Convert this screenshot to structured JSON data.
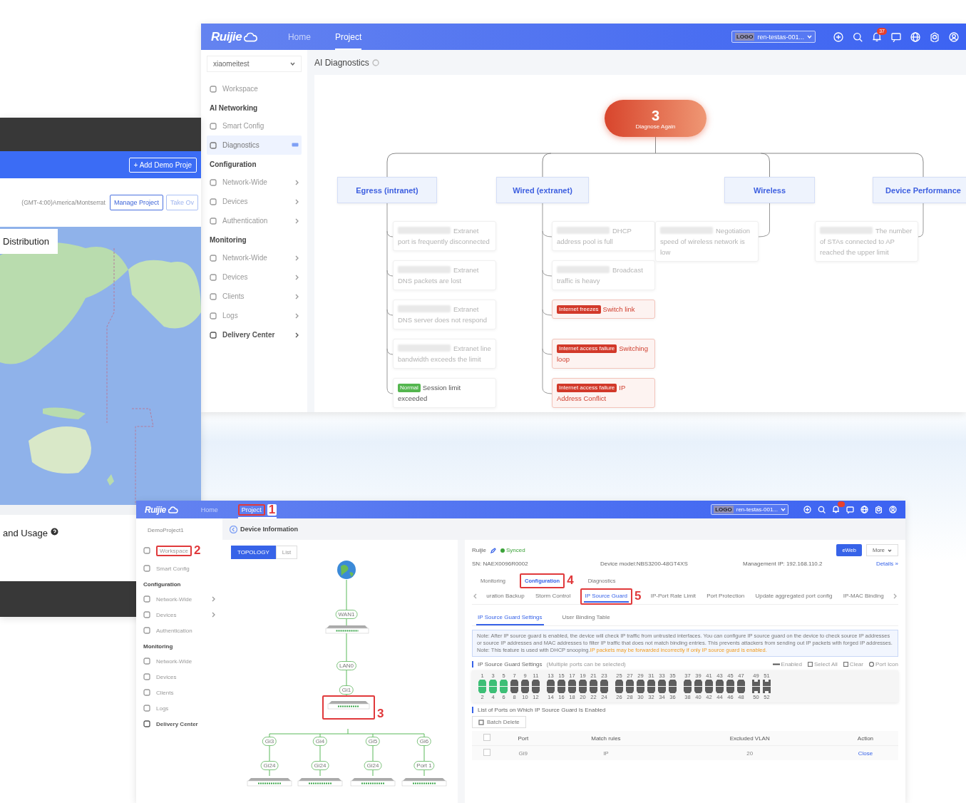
{
  "top_window": {
    "header": {
      "logo": "Ruijie",
      "nav": [
        {
          "label": "Home",
          "selected": false
        },
        {
          "label": "Project",
          "selected": true
        }
      ],
      "project_select": {
        "logo": "LOGO",
        "value": "ren-testas-001..."
      },
      "notification_count": "37"
    },
    "sidebar": {
      "project": "xiaomeitest",
      "items": [
        {
          "kind": "link",
          "label": "Workspace",
          "selected": false,
          "submenu": false,
          "badge": false
        },
        {
          "kind": "heading",
          "label": "AI Networking"
        },
        {
          "kind": "link",
          "label": "Smart Config",
          "selected": false,
          "submenu": false,
          "badge": false
        },
        {
          "kind": "link",
          "label": "Diagnostics",
          "selected": true,
          "submenu": false,
          "badge": true
        },
        {
          "kind": "heading",
          "label": "Configuration"
        },
        {
          "kind": "link",
          "label": "Network-Wide",
          "selected": false,
          "submenu": true,
          "badge": false
        },
        {
          "kind": "link",
          "label": "Devices",
          "selected": false,
          "submenu": true,
          "badge": false
        },
        {
          "kind": "link",
          "label": "Authentication",
          "selected": false,
          "submenu": true,
          "badge": false
        },
        {
          "kind": "heading",
          "label": "Monitoring"
        },
        {
          "kind": "link",
          "label": "Network-Wide",
          "selected": false,
          "submenu": true,
          "badge": false
        },
        {
          "kind": "link",
          "label": "Devices",
          "selected": false,
          "submenu": true,
          "badge": false
        },
        {
          "kind": "link",
          "label": "Clients",
          "selected": false,
          "submenu": true,
          "badge": false
        },
        {
          "kind": "link",
          "label": "Logs",
          "selected": false,
          "submenu": true,
          "badge": false
        },
        {
          "kind": "group",
          "label": "Delivery Center",
          "selected": false,
          "submenu": true,
          "badge": false
        }
      ]
    },
    "page_title": "AI Diagnostics",
    "diagnosis": {
      "count": "3",
      "action": "Diagnose Again",
      "categories": [
        {
          "name": "Egress (intranet)",
          "issues": [
            {
              "kind": "pending",
              "text": "Extranet port is frequently disconnected"
            },
            {
              "kind": "pending",
              "text": "Extranet DNS packets are lost"
            },
            {
              "kind": "pending",
              "text": "Extranet DNS server does not respond"
            },
            {
              "kind": "pending",
              "text": "Extranet line bandwidth exceeds the limit"
            },
            {
              "kind": "normal",
              "tag": "Normal",
              "text": "Session limit exceeded"
            }
          ]
        },
        {
          "name": "Wired (extranet)",
          "issues": [
            {
              "kind": "pending",
              "text": "DHCP address pool is full"
            },
            {
              "kind": "pending",
              "text": "Broadcast traffic is heavy"
            },
            {
              "kind": "fault",
              "tag": "Internet freezes",
              "text": "Switch link"
            },
            {
              "kind": "fault",
              "tag": "Internet access failure",
              "text": "Switching loop"
            },
            {
              "kind": "fault",
              "tag": "Internet access failure",
              "text": "IP Address Conflict"
            }
          ]
        },
        {
          "name": "Wireless",
          "issues": [
            {
              "kind": "pending",
              "text": "Negotiation speed of wireless network is low"
            }
          ]
        },
        {
          "name": "Device Performance",
          "issues": [
            {
              "kind": "pending",
              "text": "The number of STAs connected to AP reached the upper limit"
            }
          ]
        }
      ]
    }
  },
  "map_window": {
    "add_button": "+ Add Demo Proje",
    "timezone": "(GMT-4:00)America/Montserrat",
    "buttons": [
      "Manage Project",
      "Take Ov"
    ],
    "map_title": "Distribution",
    "usage_title": "and Usage"
  },
  "bottom_window": {
    "header": {
      "logo": "Ruijie",
      "nav": [
        {
          "label": "Home",
          "selected": false
        },
        {
          "label": "Project",
          "selected": true,
          "callout": "1"
        }
      ],
      "project_select": {
        "logo": "LOGO",
        "value": "ren-testas-001..."
      }
    },
    "sidebar": {
      "project": "DemoProject1",
      "items": [
        {
          "kind": "link",
          "label": "Workspace",
          "selected": false,
          "submenu": false,
          "callout": "2"
        },
        {
          "kind": "link",
          "label": "Smart Config",
          "selected": false,
          "submenu": false
        },
        {
          "kind": "heading",
          "label": "Configuration"
        },
        {
          "kind": "link",
          "label": "Network-Wide",
          "selected": false,
          "submenu": true
        },
        {
          "kind": "link",
          "label": "Devices",
          "selected": false,
          "submenu": true
        },
        {
          "kind": "link",
          "label": "Authentication",
          "selected": false,
          "submenu": false
        },
        {
          "kind": "heading",
          "label": "Monitoring"
        },
        {
          "kind": "link",
          "label": "Network-Wide",
          "selected": false,
          "submenu": false
        },
        {
          "kind": "link",
          "label": "Devices",
          "selected": false,
          "submenu": false
        },
        {
          "kind": "link",
          "label": "Clients",
          "selected": false,
          "submenu": false
        },
        {
          "kind": "link",
          "label": "Logs",
          "selected": false,
          "submenu": false
        },
        {
          "kind": "group",
          "label": "Delivery Center",
          "selected": false,
          "submenu": false
        }
      ]
    },
    "page_title": "Device Information",
    "view_tabs": [
      {
        "label": "TOPOLOGY",
        "selected": true
      },
      {
        "label": "List",
        "selected": false
      }
    ],
    "topology": {
      "uplinks": [
        "WAN1",
        "LAN0",
        "Gi1"
      ],
      "selected_callout": "3",
      "downlinks": [
        {
          "upper": "Gi3",
          "lower": "Gi24"
        },
        {
          "upper": "Gi4",
          "lower": "Gi24"
        },
        {
          "upper": "Gi5",
          "lower": "Gi24"
        },
        {
          "upper": "Gi6",
          "lower": "Port 1"
        }
      ]
    },
    "device": {
      "name": "Ruijie",
      "status": "Synced",
      "web_button": "eWeb",
      "more_button": "More",
      "sn": "SN:  NAEX0096R0002",
      "model": "Device model:NBS3200-48GT4XS",
      "ip": "Management IP:  192.168.110.2",
      "details": "Details »"
    },
    "tabs": [
      {
        "label": "Monitoring",
        "selected": false
      },
      {
        "label": "Configuration",
        "selected": true,
        "callout": "4"
      },
      {
        "label": "Diagnostics",
        "selected": false
      }
    ],
    "subtabs": [
      {
        "label": "uration Backup",
        "selected": false
      },
      {
        "label": "Storm Control",
        "selected": false
      },
      {
        "label": "IP Source Guard",
        "selected": true,
        "callout": "5"
      },
      {
        "label": "IP-Port Rate Limit",
        "selected": false
      },
      {
        "label": "Port Protection",
        "selected": false
      },
      {
        "label": "Update aggregated port config",
        "selected": false
      },
      {
        "label": "IP-MAC Binding",
        "selected": false
      }
    ],
    "inner_tabs": [
      {
        "label": "IP Source Guard Settings",
        "selected": true
      },
      {
        "label": "User Binding Table",
        "selected": false
      }
    ],
    "note": {
      "text": "Note: After IP source guard is enabled, the device will check IP traffic from untrusted interfaces. You can configure IP source guard on the device to check source IP addresses or source IP addresses and MAC addresses to filter IP traffic that does not match binding entries. This prevents attackers from sending out IP packets with forged IP addresses.",
      "text2": "Note: This feature is used with DHCP snooping.",
      "warning": "IP packets may be forwarded incorrectly if only IP source guard is enabled."
    },
    "port_panel": {
      "title": "IP Source Guard Settings",
      "hint": "(Multiple ports can be selected)",
      "legend": [
        "Enabled",
        "Select All",
        "Clear",
        "Port Icon"
      ],
      "ports": [
        {
          "number": "1",
          "enabled": true,
          "kind": "copper"
        },
        {
          "number": "2",
          "enabled": true,
          "kind": "copper"
        },
        {
          "number": "3",
          "enabled": true,
          "kind": "copper"
        },
        {
          "number": "4",
          "enabled": true,
          "kind": "copper"
        },
        {
          "number": "5",
          "enabled": true,
          "kind": "copper"
        },
        {
          "number": "6",
          "enabled": true,
          "kind": "copper"
        },
        {
          "number": "7",
          "enabled": false,
          "kind": "copper"
        },
        {
          "number": "8",
          "enabled": false,
          "kind": "copper"
        },
        {
          "number": "9",
          "enabled": false,
          "kind": "copper"
        },
        {
          "number": "10",
          "enabled": false,
          "kind": "copper"
        },
        {
          "number": "11",
          "enabled": false,
          "kind": "copper"
        },
        {
          "number": "12",
          "enabled": false,
          "kind": "copper"
        },
        {
          "number": "13",
          "enabled": false,
          "kind": "copper"
        },
        {
          "number": "14",
          "enabled": false,
          "kind": "copper"
        },
        {
          "number": "15",
          "enabled": false,
          "kind": "copper"
        },
        {
          "number": "16",
          "enabled": false,
          "kind": "copper"
        },
        {
          "number": "17",
          "enabled": false,
          "kind": "copper"
        },
        {
          "number": "18",
          "enabled": false,
          "kind": "copper"
        },
        {
          "number": "19",
          "enabled": false,
          "kind": "copper"
        },
        {
          "number": "20",
          "enabled": false,
          "kind": "copper"
        },
        {
          "number": "21",
          "enabled": false,
          "kind": "copper"
        },
        {
          "number": "22",
          "enabled": false,
          "kind": "copper"
        },
        {
          "number": "23",
          "enabled": false,
          "kind": "copper"
        },
        {
          "number": "24",
          "enabled": false,
          "kind": "copper"
        },
        {
          "number": "25",
          "enabled": false,
          "kind": "copper"
        },
        {
          "number": "26",
          "enabled": false,
          "kind": "copper"
        },
        {
          "number": "27",
          "enabled": false,
          "kind": "copper"
        },
        {
          "number": "28",
          "enabled": false,
          "kind": "copper"
        },
        {
          "number": "29",
          "enabled": false,
          "kind": "copper"
        },
        {
          "number": "30",
          "enabled": false,
          "kind": "copper"
        },
        {
          "number": "31",
          "enabled": false,
          "kind": "copper"
        },
        {
          "number": "32",
          "enabled": false,
          "kind": "copper"
        },
        {
          "number": "33",
          "enabled": false,
          "kind": "copper"
        },
        {
          "number": "34",
          "enabled": false,
          "kind": "copper"
        },
        {
          "number": "35",
          "enabled": false,
          "kind": "copper"
        },
        {
          "number": "36",
          "enabled": false,
          "kind": "copper"
        },
        {
          "number": "37",
          "enabled": false,
          "kind": "copper"
        },
        {
          "number": "38",
          "enabled": false,
          "kind": "copper"
        },
        {
          "number": "39",
          "enabled": false,
          "kind": "copper"
        },
        {
          "number": "40",
          "enabled": false,
          "kind": "copper"
        },
        {
          "number": "41",
          "enabled": false,
          "kind": "copper"
        },
        {
          "number": "42",
          "enabled": false,
          "kind": "copper"
        },
        {
          "number": "43",
          "enabled": false,
          "kind": "copper"
        },
        {
          "number": "44",
          "enabled": false,
          "kind": "copper"
        },
        {
          "number": "45",
          "enabled": false,
          "kind": "copper"
        },
        {
          "number": "46",
          "enabled": false,
          "kind": "copper"
        },
        {
          "number": "47",
          "enabled": false,
          "kind": "copper"
        },
        {
          "number": "48",
          "enabled": false,
          "kind": "copper"
        },
        {
          "number": "49",
          "enabled": false,
          "kind": "fiber"
        },
        {
          "number": "50",
          "enabled": false,
          "kind": "fiber"
        },
        {
          "number": "51",
          "enabled": false,
          "kind": "fiber"
        },
        {
          "number": "52",
          "enabled": false,
          "kind": "fiber"
        }
      ]
    },
    "list_title": "List of Ports on Which IP Source Guard Is Enabled",
    "batch_delete": "Batch Delete",
    "table": {
      "select_all": false,
      "columns": [
        "Port",
        "Match rules",
        "Excluded VLAN",
        "Action"
      ],
      "rows": [
        {
          "selected": false,
          "cells": [
            "Gi9",
            "IP",
            "20",
            "Close"
          ]
        }
      ]
    }
  }
}
